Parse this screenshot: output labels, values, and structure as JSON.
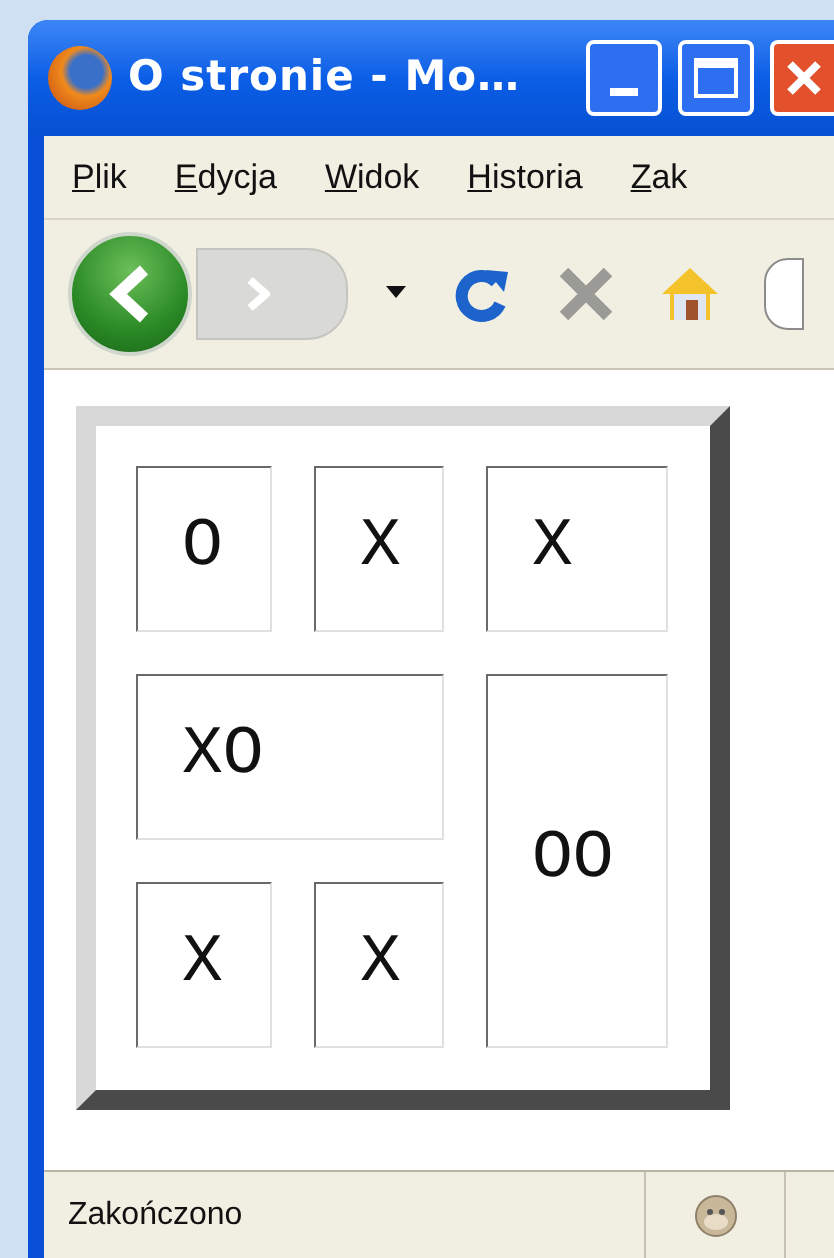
{
  "window": {
    "title": "O stronie - Mo…"
  },
  "menu": [
    {
      "label": "Plik"
    },
    {
      "label": "Edycja"
    },
    {
      "label": "Widok"
    },
    {
      "label": "Historia"
    },
    {
      "label": "Zak"
    }
  ],
  "table": {
    "cells": [
      {
        "text": "O"
      },
      {
        "text": "X"
      },
      {
        "text": "X"
      },
      {
        "text": "XO",
        "colspan": 2
      },
      {
        "text": "OO",
        "rowspan": 2
      },
      {
        "text": "X"
      },
      {
        "text": "X"
      }
    ]
  },
  "status_bar": {
    "text": "Zakończono"
  }
}
